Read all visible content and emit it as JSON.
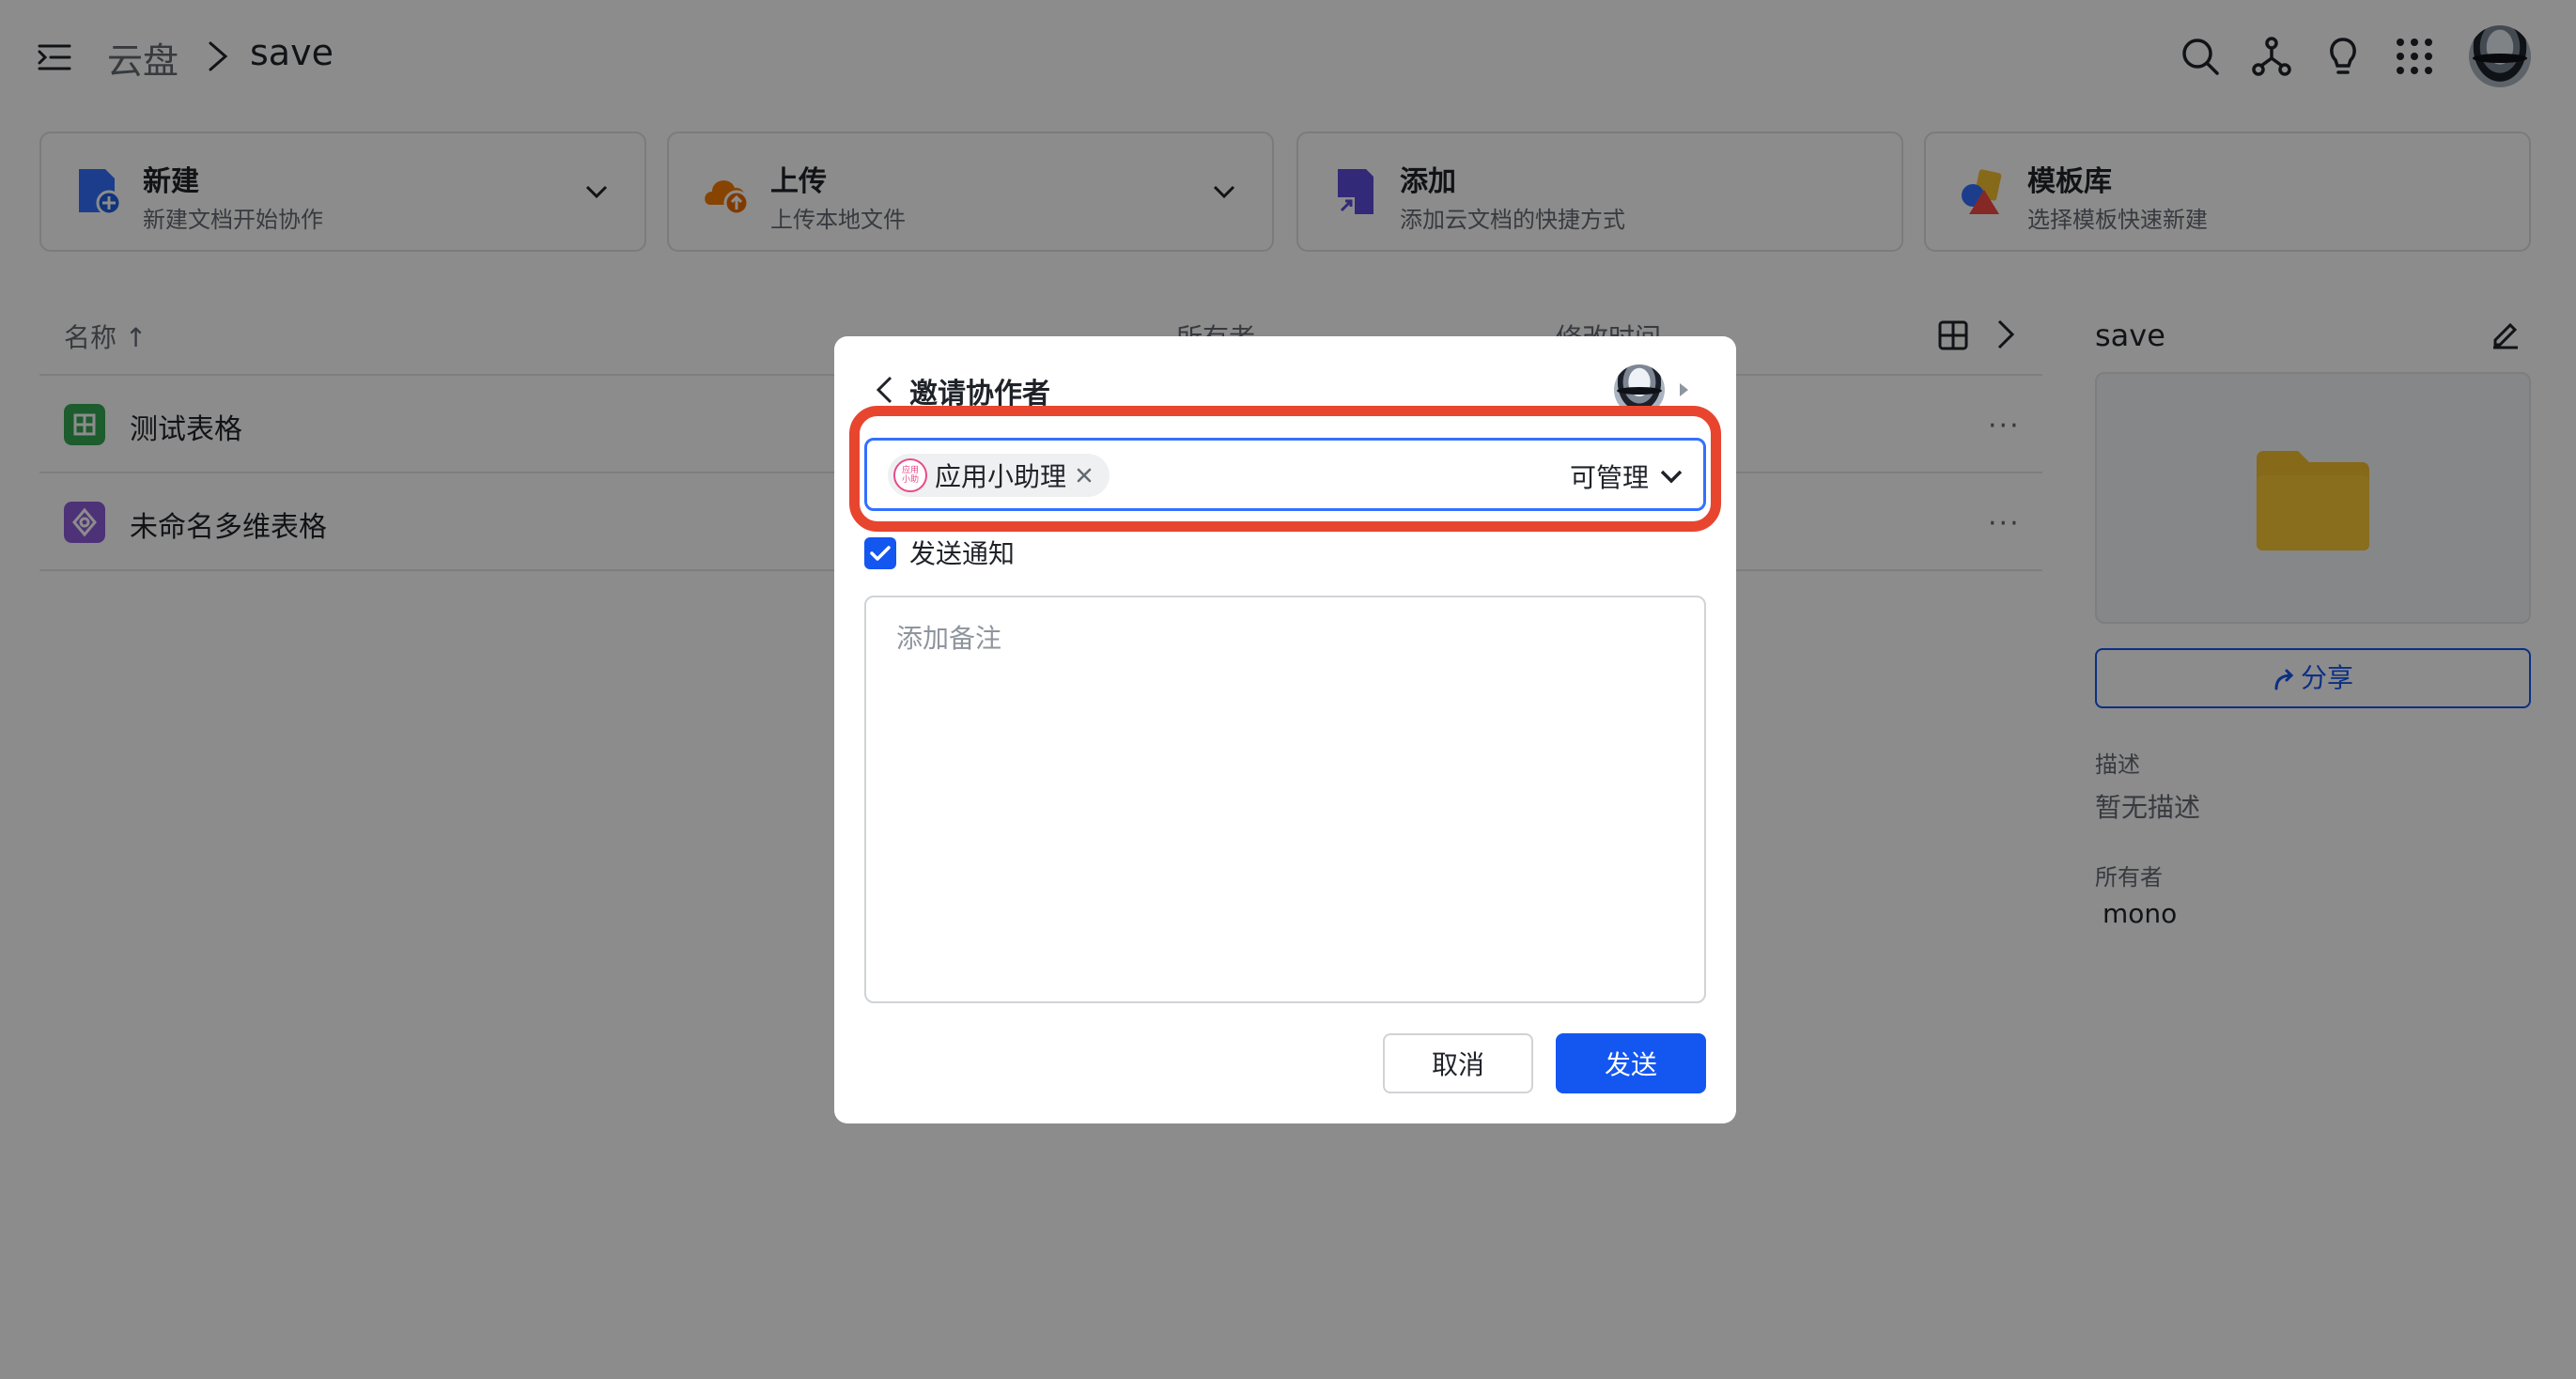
{
  "header": {
    "breadcrumb_root": "云盘",
    "breadcrumb_current": "save"
  },
  "cards": [
    {
      "title": "新建",
      "subtitle": "新建文档开始协作",
      "icon": "new-doc-icon"
    },
    {
      "title": "上传",
      "subtitle": "上传本地文件",
      "icon": "upload-cloud-icon"
    },
    {
      "title": "添加",
      "subtitle": "添加云文档的快捷方式",
      "icon": "shortcut-icon"
    },
    {
      "title": "模板库",
      "subtitle": "选择模板快速新建",
      "icon": "template-icon"
    }
  ],
  "list": {
    "columns": {
      "name": "名称 ↑",
      "owner": "所有者",
      "modified": "修改时间"
    },
    "rows": [
      {
        "name": "测试表格",
        "type": "sheet",
        "color": "#34a853"
      },
      {
        "name": "未命名多维表格",
        "type": "bitable",
        "color": "#8e5cd9"
      }
    ],
    "more_label": "···"
  },
  "panel": {
    "title": "save",
    "share_label": "分享",
    "desc_label": "描述",
    "desc_value": "暂无描述",
    "owner_label": "所有者",
    "owner_value": "mono"
  },
  "dialog": {
    "title": "邀请协作者",
    "chip": {
      "avatar_text_1": "应用",
      "avatar_text_2": "小助",
      "label": "应用小助理"
    },
    "permission": "可管理",
    "notify_label": "发送通知",
    "notify_checked": true,
    "note_placeholder": "添加备注",
    "cancel_label": "取消",
    "send_label": "发送"
  },
  "colors": {
    "accent": "#1456f0",
    "highlight": "#e8452f",
    "folder": "#f5c02e"
  }
}
